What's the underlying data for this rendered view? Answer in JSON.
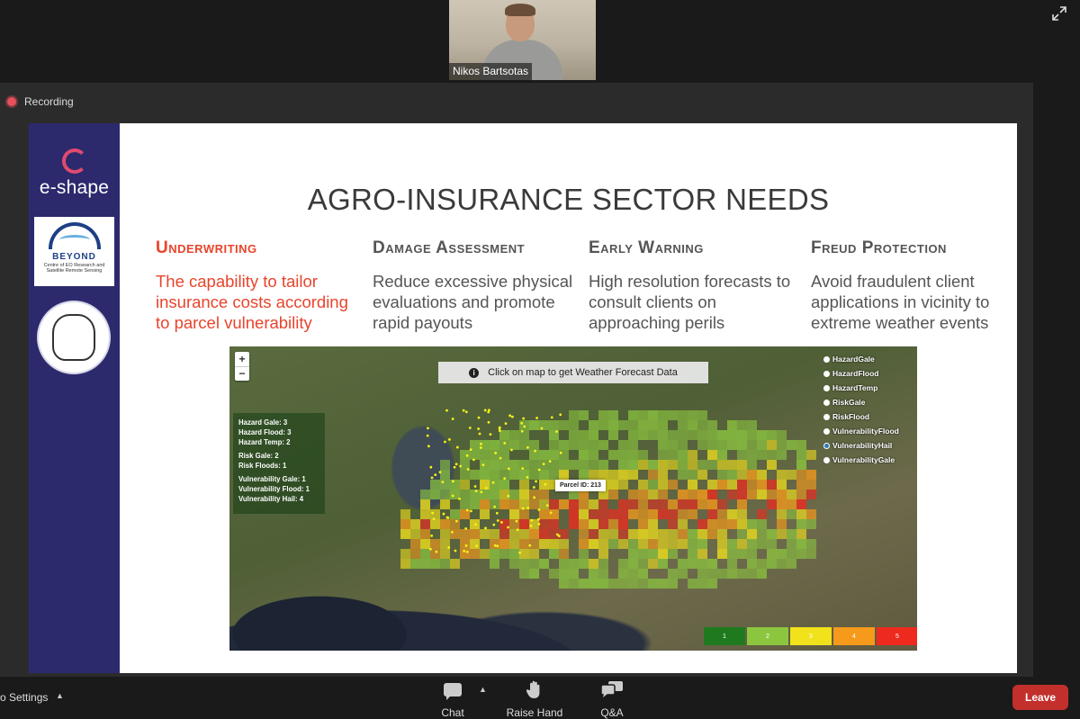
{
  "participant": {
    "name": "Nikos Bartsotas"
  },
  "share": {
    "recording_label": "Recording"
  },
  "slide": {
    "sidebar": {
      "logo_text": "e-shape",
      "beyond_name": "BEYOND",
      "beyond_sub": "Centre of EO Research and Satellite Remote Sensing"
    },
    "title": "AGRO-INSURANCE SECTOR NEEDS",
    "columns": [
      {
        "heading": "Underwriting",
        "body": "The capability to tailor insurance costs according to parcel vulnerability"
      },
      {
        "heading": "Damage Assessment",
        "body": "Reduce excessive physical evaluations and promote rapid payouts"
      },
      {
        "heading": "Early Warning",
        "body": "High resolution forecasts to consult clients on approaching perils"
      },
      {
        "heading": "Freud Protection",
        "body": "Avoid fraudulent client applications in vicinity to extreme weather events"
      }
    ],
    "map": {
      "zoom_in": "+",
      "zoom_out": "−",
      "banner": "Click on map to get Weather Forecast Data",
      "layers": [
        "HazardGale",
        "HazardFlood",
        "HazardTemp",
        "RiskGale",
        "RiskFlood",
        "VulnerabilityFlood",
        "VulnerabilityHail",
        "VulnerabilityGale"
      ],
      "selected_layer": "VulnerabilityHail",
      "stats": [
        "Hazard Gale: 3",
        "Hazard Flood: 3",
        "Hazard Temp: 2",
        "Risk Gale: 2",
        "Risk Floods: 1",
        "Vulnerability Gale: 1",
        "Vulnerability Flood: 1",
        "Vulnerability Hail: 4"
      ],
      "parcel_label": "Parcel ID: 213",
      "legend": [
        {
          "label": "1",
          "color": "#1f7a1f"
        },
        {
          "label": "2",
          "color": "#8cc63f"
        },
        {
          "label": "3",
          "color": "#f2e21c"
        },
        {
          "label": "4",
          "color": "#f59a1b"
        },
        {
          "label": "5",
          "color": "#ee2a1f"
        }
      ]
    }
  },
  "toolbar": {
    "settings_label": "o Settings",
    "chat_label": "Chat",
    "raise_hand_label": "Raise Hand",
    "qa_label": "Q&A",
    "leave_label": "Leave"
  }
}
